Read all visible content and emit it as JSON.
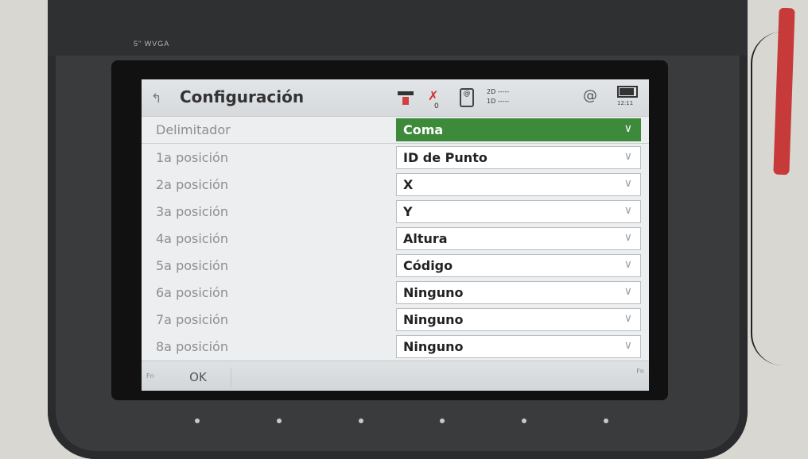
{
  "device": {
    "model_label": "5\" WVGA"
  },
  "header": {
    "title": "Configuración",
    "status": {
      "satellites": "0",
      "quality_2d": "2D -----",
      "quality_1d": "1D -----",
      "clock": "12:11"
    }
  },
  "rows": [
    {
      "label": "Delimitador",
      "value": "Coma"
    },
    {
      "label": "1a posición",
      "value": "ID de Punto"
    },
    {
      "label": "2a posición",
      "value": "X"
    },
    {
      "label": "3a posición",
      "value": "Y"
    },
    {
      "label": "4a posición",
      "value": "Altura"
    },
    {
      "label": "5a posición",
      "value": "Código"
    },
    {
      "label": "6a posición",
      "value": "Ninguno"
    },
    {
      "label": "7a posición",
      "value": "Ninguno"
    },
    {
      "label": "8a posición",
      "value": "Ninguno"
    }
  ],
  "footer": {
    "fn_left": "Fn",
    "ok_label": "OK",
    "fn_right": "Fn"
  },
  "colors": {
    "active_select": "#3d8a3b",
    "alert": "#d04040"
  },
  "icons": {
    "back": "back-arrow-icon",
    "antenna": "antenna-icon",
    "satellite": "satellite-icon",
    "phone": "phone-icon",
    "at": "at-icon",
    "battery": "battery-icon"
  }
}
